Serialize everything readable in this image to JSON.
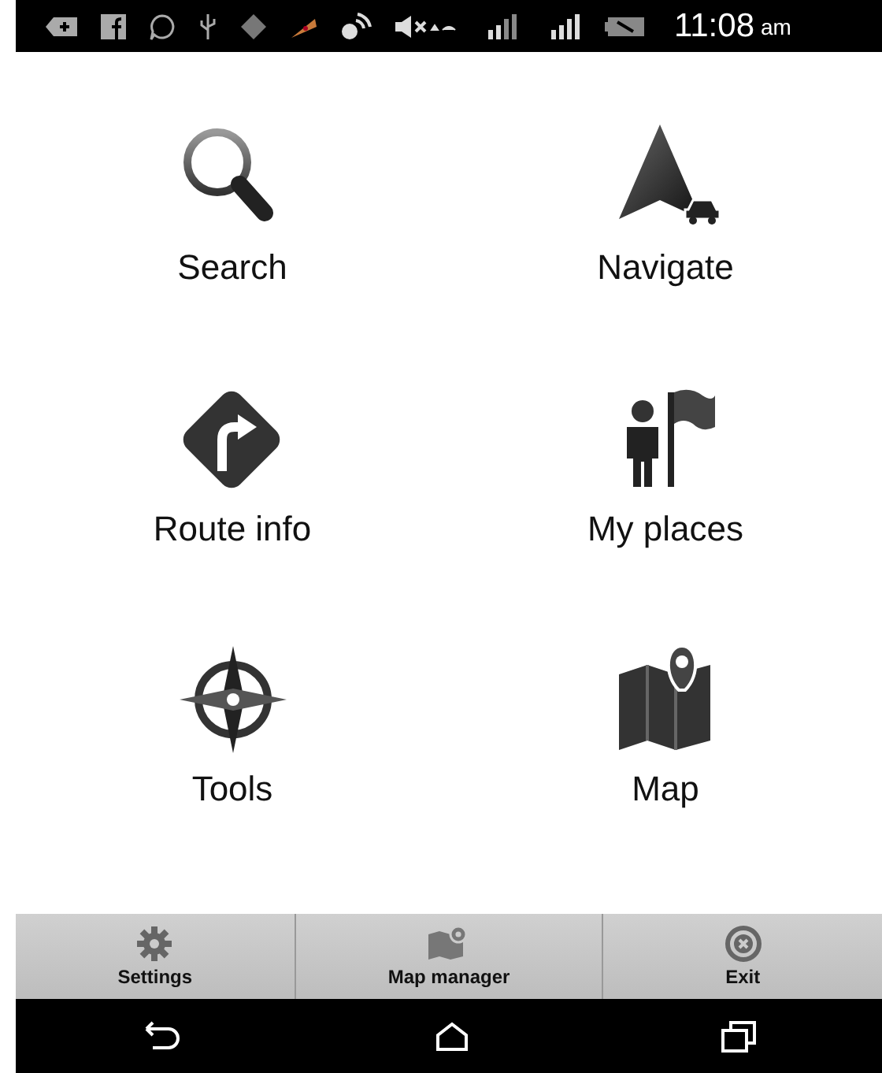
{
  "status_bar": {
    "time": "11:08",
    "meridiem": "am"
  },
  "menu": [
    {
      "label": "Search",
      "kind": "search"
    },
    {
      "label": "Navigate",
      "kind": "navigate"
    },
    {
      "label": "Route info",
      "kind": "route"
    },
    {
      "label": "My places",
      "kind": "places"
    },
    {
      "label": "Tools",
      "kind": "tools"
    },
    {
      "label": "Map",
      "kind": "map"
    }
  ],
  "toolbar": [
    {
      "label": "Settings",
      "kind": "settings"
    },
    {
      "label": "Map manager",
      "kind": "mapmanager"
    },
    {
      "label": "Exit",
      "kind": "exit"
    }
  ],
  "nav_bar": [
    {
      "kind": "back"
    },
    {
      "kind": "home"
    },
    {
      "kind": "recents"
    }
  ]
}
